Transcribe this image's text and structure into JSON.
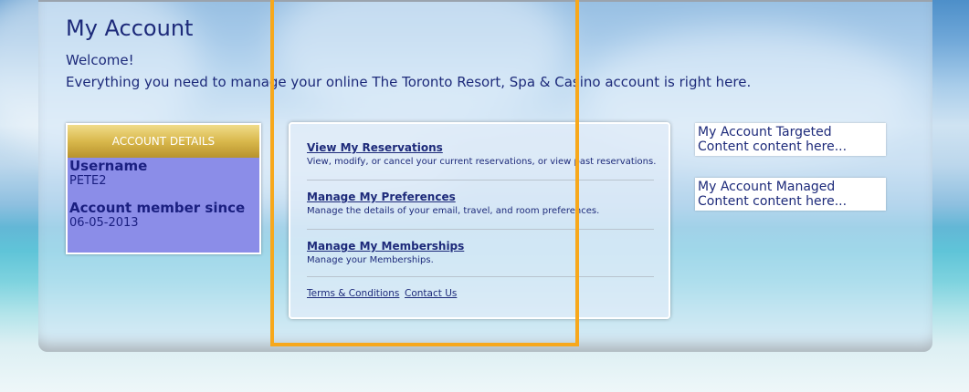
{
  "page": {
    "title": "My Account",
    "welcome": "Welcome!",
    "intro": "Everything you need to manage your online The Toronto Resort, Spa & Casino account is right here."
  },
  "account_details": {
    "header": "ACCOUNT DETAILS",
    "username_label": "Username",
    "username_value": "PETE2",
    "member_since_label": "Account member since",
    "member_since_value": "06-05-2013"
  },
  "links": [
    {
      "title": "View My Reservations",
      "desc": "View, modify, or cancel your current reservations, or view past reservations."
    },
    {
      "title": "Manage My Preferences",
      "desc": "Manage the details of your email, travel, and room preferences."
    },
    {
      "title": "Manage My Memberships",
      "desc": "Manage your Memberships."
    }
  ],
  "footer": {
    "terms": "Terms & Conditions",
    "contact": "Contact Us"
  },
  "side": {
    "targeted": "My Account Targeted Content content here...",
    "managed": "My Account Managed Content content here..."
  },
  "colors": {
    "text": "#1d2a7a",
    "account_box": "#8b8de8",
    "highlight_frame": "#f7a81c"
  }
}
